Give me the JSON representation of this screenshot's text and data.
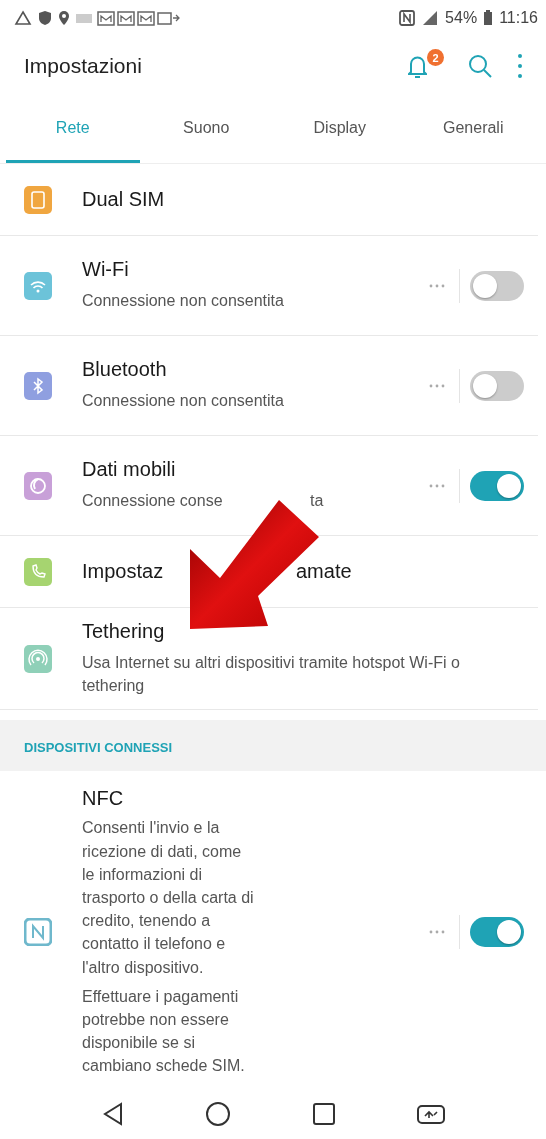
{
  "status_bar": {
    "battery": "54%",
    "time": "11:16"
  },
  "header": {
    "title": "Impostazioni",
    "notification_badge": "2"
  },
  "tabs": [
    {
      "label": "Rete",
      "selected": true
    },
    {
      "label": "Suono",
      "selected": false
    },
    {
      "label": "Display",
      "selected": false
    },
    {
      "label": "Generali",
      "selected": false
    }
  ],
  "items": [
    {
      "kind": "plain",
      "title": "Dual SIM",
      "color": "#f0a640"
    },
    {
      "kind": "toggle",
      "title": "Wi-Fi",
      "subtitle": "Connessione non consentita",
      "on": false,
      "color": "#6cc3d9"
    },
    {
      "kind": "toggle",
      "title": "Bluetooth",
      "subtitle": "Connessione non consentita",
      "on": false,
      "color": "#8f9fe0"
    },
    {
      "kind": "toggle",
      "title": "Dati mobili",
      "subtitle": "Connessione conse",
      "subtitle_tail": "ta",
      "on": true,
      "color": "#c8a0d8"
    },
    {
      "kind": "plain",
      "title": "Impostaz",
      "title_tail": "amate",
      "color": "#a6d470"
    },
    {
      "kind": "plain",
      "title": "Tethering",
      "subtitle": "Usa Internet su altri dispositivi tramite hotspot Wi-Fi o tethering",
      "color": "#8fd0b8"
    }
  ],
  "section": {
    "header": "DISPOSITIVI CONNESSI"
  },
  "nfc": {
    "title": "NFC",
    "paragraphs": [
      "Consenti l'invio e la ricezione di dati, come le informazioni di trasporto o della carta di credito, tenendo a contatto il telefono e l'altro dispositivo.",
      "Effettuare i pagamenti potrebbe non essere disponibile se si cambiano schede SIM."
    ],
    "on": true,
    "color": "#6fb8cc"
  }
}
